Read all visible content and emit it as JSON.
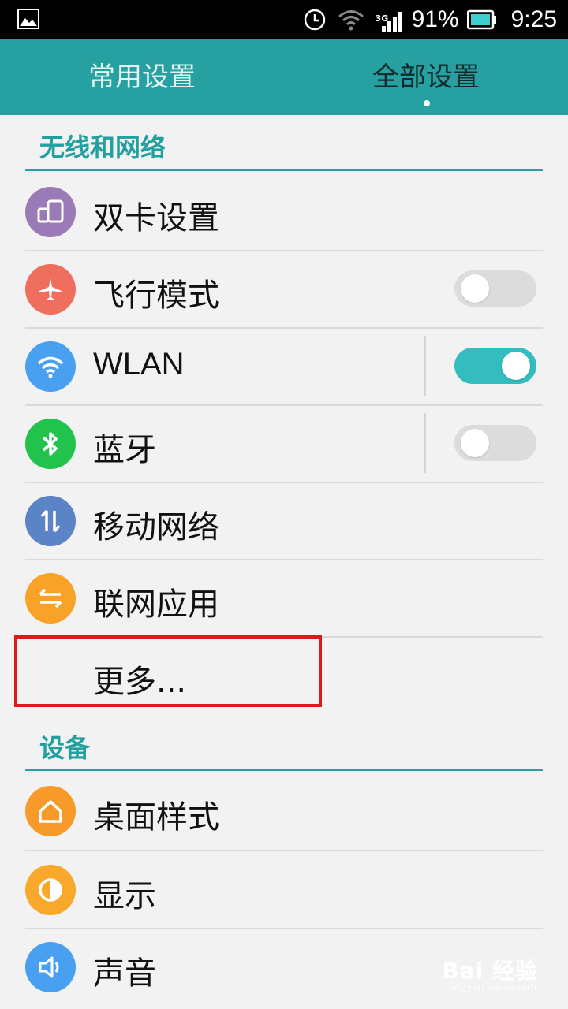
{
  "status_bar": {
    "network_label": "3G",
    "battery_percent": "91%",
    "time": "9:25",
    "icons": [
      "image-icon",
      "alarm-icon",
      "wifi-icon",
      "signal-icon",
      "battery-icon"
    ]
  },
  "tabs": [
    {
      "label": "常用设置",
      "active": false
    },
    {
      "label": "全部设置",
      "active": true
    }
  ],
  "sections": [
    {
      "title": "无线和网络",
      "items": [
        {
          "label": "双卡设置",
          "icon": "dual-sim-icon",
          "icon_color": "#9b7ab8"
        },
        {
          "label": "飞行模式",
          "icon": "airplane-icon",
          "icon_color": "#ef6e5e",
          "toggle": "off"
        },
        {
          "label": "WLAN",
          "icon": "wifi-icon",
          "icon_color": "#4aa0f0",
          "toggle": "on"
        },
        {
          "label": "蓝牙",
          "icon": "bluetooth-icon",
          "icon_color": "#22c34d",
          "toggle": "off"
        },
        {
          "label": "移动网络",
          "icon": "mobile-data-icon",
          "icon_color": "#5a84c6"
        },
        {
          "label": "联网应用",
          "icon": "network-apps-icon",
          "icon_color": "#f8a227"
        },
        {
          "label": "更多..."
        }
      ]
    },
    {
      "title": "设备",
      "items": [
        {
          "label": "桌面样式",
          "icon": "home-icon",
          "icon_color": "#f89a2a"
        },
        {
          "label": "显示",
          "icon": "display-icon",
          "icon_color": "#f8a82a"
        },
        {
          "label": "声音",
          "icon": "sound-icon",
          "icon_color": "#4aa0f0"
        }
      ]
    }
  ],
  "watermark": {
    "text": "Bai 经验",
    "sub": "jingyan.baidu.com"
  },
  "colors": {
    "accent": "#26a0a0",
    "highlight": "#d61d1d",
    "toggle_on": "#35bcbf"
  }
}
